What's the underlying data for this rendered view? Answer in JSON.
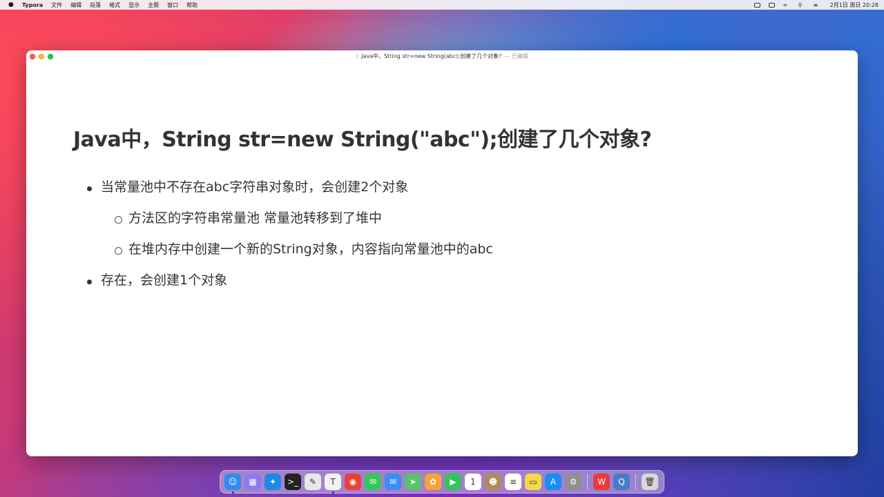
{
  "menubar": {
    "apple": "",
    "app_name": "Typora",
    "items": [
      "文件",
      "编辑",
      "段落",
      "格式",
      "显示",
      "主题",
      "窗口",
      "帮助"
    ],
    "clock": "2月1日 周日 20:28"
  },
  "window": {
    "title": "Java中，String str=new String(abc);创建了几个对象?",
    "edited_label": "— 已编辑"
  },
  "document": {
    "heading": "Java中，String str=new String(\"abc\");创建了几个对象?",
    "bullets": [
      {
        "text": "当常量池中不存在abc字符串对象时，会创建2个对象",
        "children": [
          "方法区的字符串常量池 常量池转移到了堆中",
          "在堆内存中创建一个新的String对象，内容指向常量池中的abc"
        ]
      },
      {
        "text": "存在，会创建1个对象",
        "children": []
      }
    ]
  },
  "dock": {
    "icons": [
      {
        "name": "finder-icon",
        "glyph": "☺",
        "color": "#2f8cf0"
      },
      {
        "name": "launchpad-icon",
        "glyph": "▦",
        "color": "#8a7cf0"
      },
      {
        "name": "safari-icon",
        "glyph": "✦",
        "color": "#1e88e5"
      },
      {
        "name": "terminal-icon",
        "glyph": ">_",
        "color": "#222222"
      },
      {
        "name": "textedit-icon",
        "glyph": "✎",
        "color": "#e8e8e8"
      },
      {
        "name": "typora-icon",
        "glyph": "T",
        "color": "#f2f2f2"
      },
      {
        "name": "chrome-icon",
        "glyph": "◉",
        "color": "#e94235"
      },
      {
        "name": "messages-icon",
        "glyph": "✉",
        "color": "#34c759"
      },
      {
        "name": "mail-icon",
        "glyph": "✉",
        "color": "#3a8ef6"
      },
      {
        "name": "maps-icon",
        "glyph": "➤",
        "color": "#5ac26d"
      },
      {
        "name": "photos-icon",
        "glyph": "✿",
        "color": "#f7a33c"
      },
      {
        "name": "facetime-icon",
        "glyph": "▶",
        "color": "#32c45a"
      },
      {
        "name": "calendar-icon",
        "glyph": "1",
        "color": "#ffffff"
      },
      {
        "name": "contacts-icon",
        "glyph": "☻",
        "color": "#b48a5a"
      },
      {
        "name": "reminders-icon",
        "glyph": "≡",
        "color": "#ffffff"
      },
      {
        "name": "notes-icon",
        "glyph": "▭",
        "color": "#f7d84a"
      },
      {
        "name": "app-store-icon",
        "glyph": "A",
        "color": "#1a8cf5"
      },
      {
        "name": "system-preferences-icon",
        "glyph": "⚙",
        "color": "#8e8e93"
      },
      {
        "name": "wps-icon",
        "glyph": "W",
        "color": "#e83b3b"
      },
      {
        "name": "quicktime-icon",
        "glyph": "Q",
        "color": "#4a7bc8"
      },
      {
        "name": "trash-icon",
        "glyph": "🗑",
        "color": "#d8d8dc"
      }
    ]
  }
}
